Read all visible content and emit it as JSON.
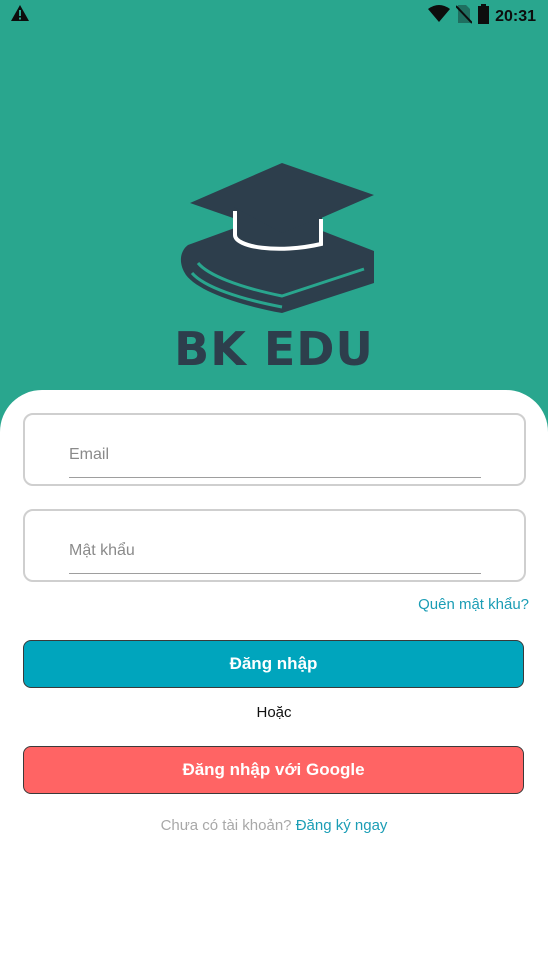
{
  "status_bar": {
    "time": "20:31",
    "icons": [
      "warning-icon",
      "wifi-icon",
      "no-sim-icon",
      "battery-icon"
    ]
  },
  "brand": {
    "name": "BK EDU",
    "logo_icon": "graduation-cap-book-icon",
    "color": "#2d3e4c"
  },
  "colors": {
    "background": "#29a68e",
    "login_button": "#00a5bd",
    "google_button": "#ff6464",
    "link": "#1b9db5"
  },
  "form": {
    "email_placeholder": "Email",
    "password_placeholder": "Mật khẩu",
    "forgot_password": "Quên mật khẩu?",
    "login_button": "Đăng nhập",
    "or_text": "Hoặc",
    "google_button": "Đăng nhập với Google",
    "signup_prompt": "Chưa có tài khoản?",
    "signup_link": "Đăng ký ngay"
  }
}
